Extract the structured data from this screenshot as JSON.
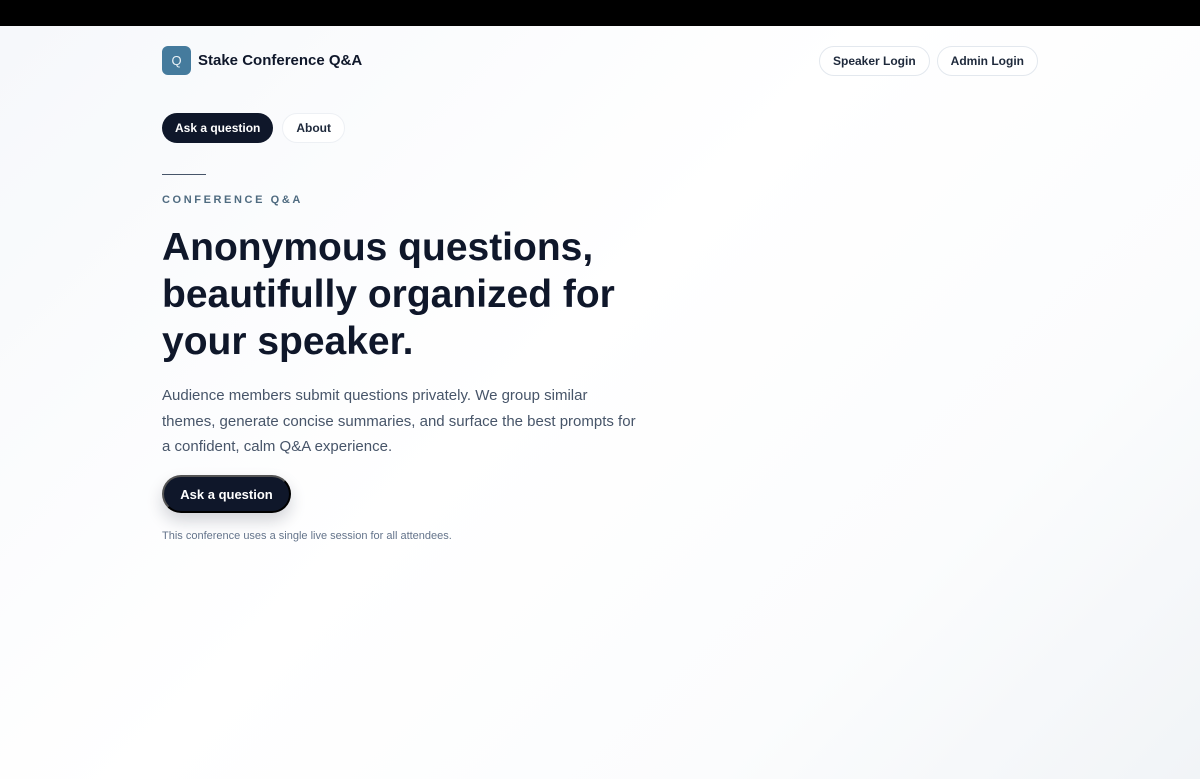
{
  "brand": {
    "logo_letter": "Q",
    "name": "Stake Conference Q&A",
    "logo_color": "#457b9d"
  },
  "header": {
    "speaker_login": "Speaker Login",
    "admin_login": "Admin Login"
  },
  "nav": {
    "tabs": [
      {
        "label": "Ask a question",
        "active": true
      },
      {
        "label": "About",
        "active": false
      }
    ]
  },
  "hero": {
    "eyebrow": "CONFERENCE Q&A",
    "headline": "Anonymous questions, beautifully organized for your speaker.",
    "description": "Audience members submit questions privately. We group similar themes, generate concise summaries, and surface the best prompts for a confident, calm Q&A experience.",
    "cta_label": "Ask a question",
    "note": "This conference uses a single live session for all attendees."
  },
  "colors": {
    "primary": "#0f172a",
    "accent": "#457b9d",
    "eyebrow": "#4f6b80"
  }
}
